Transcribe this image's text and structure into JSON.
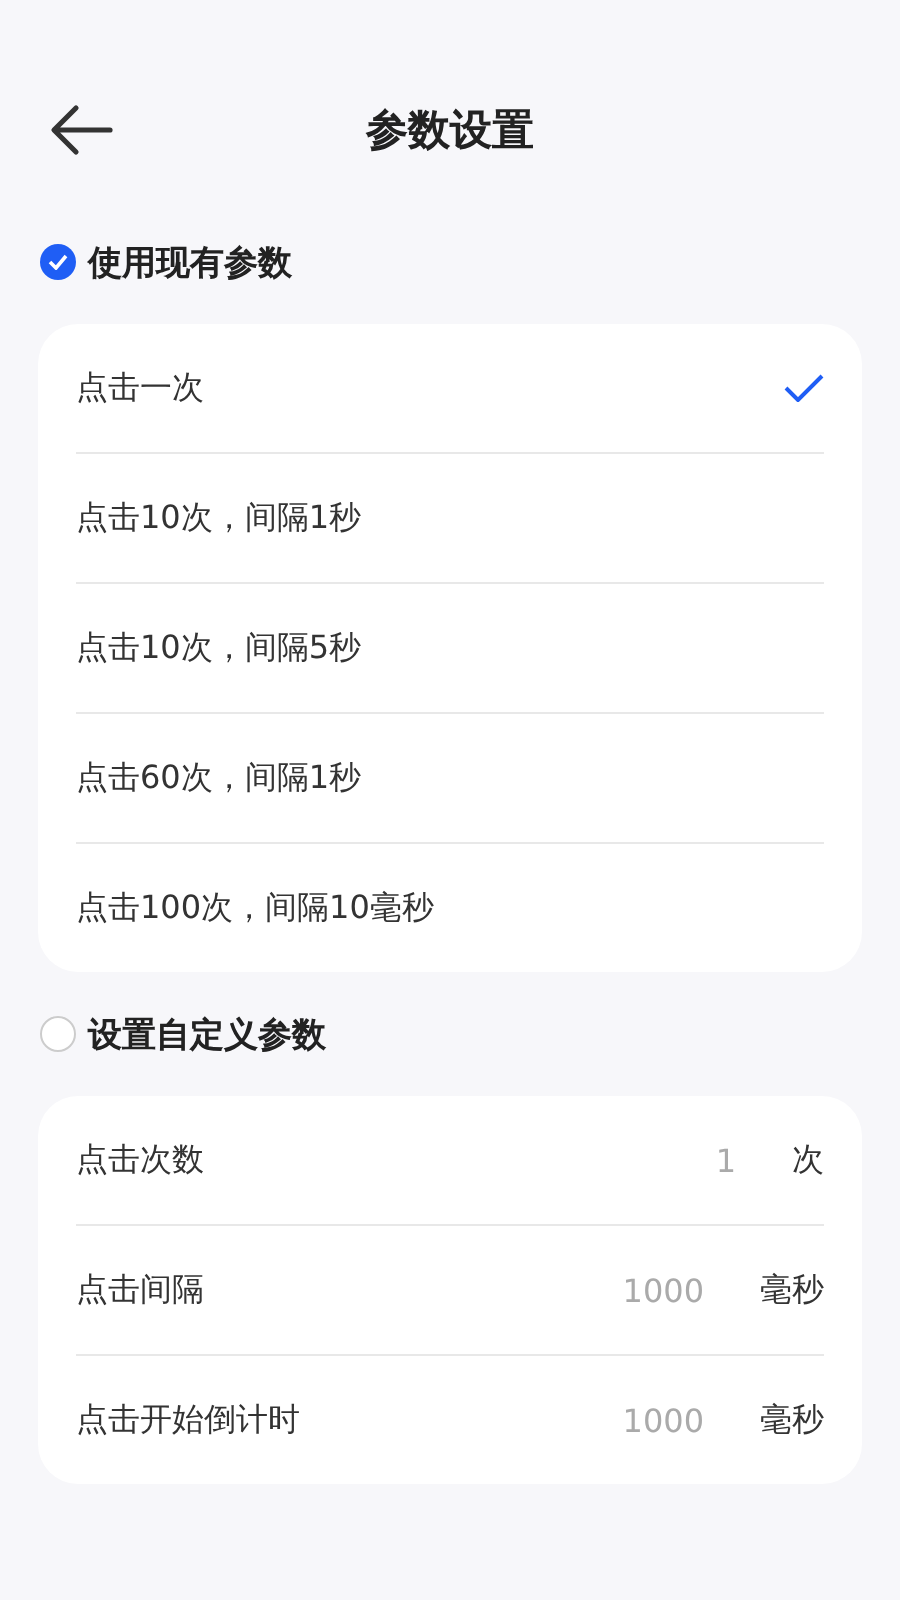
{
  "header": {
    "title": "参数设置"
  },
  "presets": {
    "label": "使用现有参数",
    "selected": true,
    "options": [
      {
        "label": "点击一次",
        "selected": true
      },
      {
        "label": "点击10次，间隔1秒",
        "selected": false
      },
      {
        "label": "点击10次，间隔5秒",
        "selected": false
      },
      {
        "label": "点击60次，间隔1秒",
        "selected": false
      },
      {
        "label": "点击100次，间隔10毫秒",
        "selected": false
      }
    ]
  },
  "custom": {
    "label": "设置自定义参数",
    "selected": false,
    "fields": [
      {
        "label": "点击次数",
        "placeholder": "1",
        "unit": "次"
      },
      {
        "label": "点击间隔",
        "placeholder": "1000",
        "unit": "毫秒"
      },
      {
        "label": "点击开始倒计时",
        "placeholder": "1000",
        "unit": "毫秒"
      }
    ]
  }
}
